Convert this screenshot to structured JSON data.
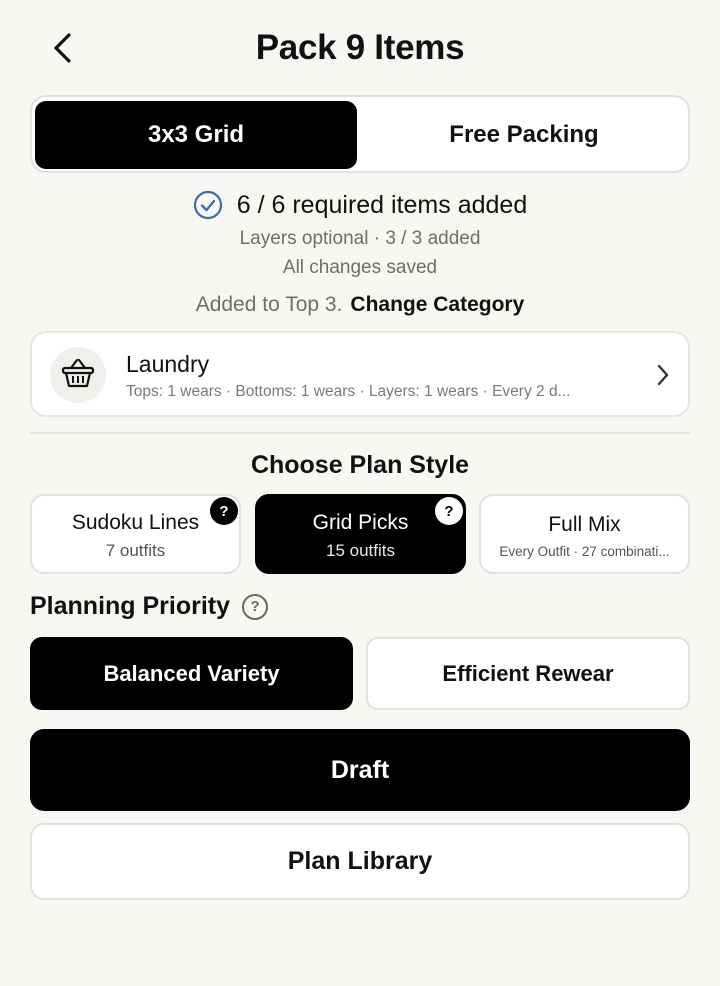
{
  "header": {
    "title": "Pack 9 Items",
    "back_icon": "chevron-left-icon"
  },
  "mode_toggle": {
    "options": [
      "3x3 Grid",
      "Free Packing"
    ],
    "selected": "3x3 Grid"
  },
  "status": {
    "check_icon": "check-circle-icon",
    "required": "6 / 6 required items added",
    "layers": "Layers optional · 3 / 3 added",
    "saved": "All changes saved",
    "added_to": "Added to Top 3.",
    "change_link": "Change Category"
  },
  "category": {
    "icon": "basket-icon",
    "name": "Laundry",
    "detail": "Tops: 1 wears · Bottoms: 1 wears · Layers: 1 wears · Every 2 d..."
  },
  "plan_style": {
    "title": "Choose Plan Style",
    "options": [
      {
        "name": "Sudoku Lines",
        "sub": "7 outfits",
        "help": "?"
      },
      {
        "name": "Grid Picks",
        "sub": "15 outfits",
        "help": "?"
      },
      {
        "name": "Full Mix",
        "sub": "Every Outfit · 27 combinati..."
      }
    ],
    "selected": "Grid Picks"
  },
  "priority": {
    "title": "Planning Priority",
    "help": "?",
    "options": [
      "Balanced Variety",
      "Efficient Rewear"
    ],
    "selected": "Balanced Variety"
  },
  "actions": {
    "primary": "Draft",
    "secondary": "Plan Library"
  },
  "colors": {
    "accent": "#000000",
    "background": "#f8f7f4",
    "check": "#3d6db5"
  }
}
